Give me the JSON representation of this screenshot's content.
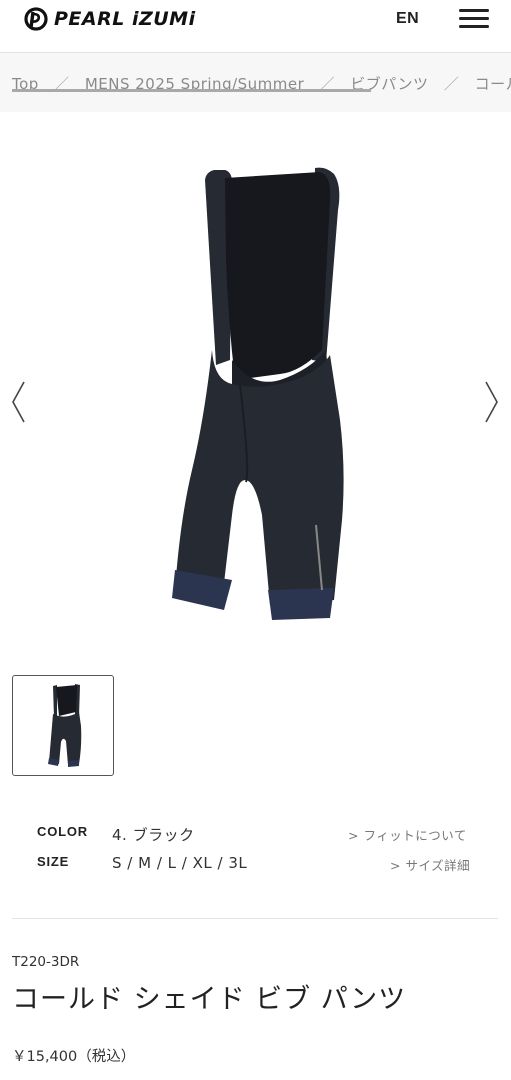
{
  "header": {
    "brand": "PEARL iZUMi",
    "lang": "EN"
  },
  "breadcrumb": {
    "items": [
      "Top",
      "MENS 2025 Spring/Summer",
      "ビブパンツ",
      "コールド シェイド ビブ パンツ"
    ],
    "separator": "／"
  },
  "product": {
    "color_label": "COLOR",
    "color_value": "4. ブラック",
    "size_label": "SIZE",
    "size_value": "S / M / L / XL / 3L",
    "fit_link": "> フィットについて",
    "size_link": "> サイズ詳細",
    "code": "T220-3DR",
    "name": "コールド シェイド ビブ パンツ",
    "price": "￥15,400（税込）"
  },
  "colors": {
    "garment": "#262a33",
    "mesh": "#17181d",
    "cuff": "#2b3550",
    "divider": "#e4e4e4"
  }
}
